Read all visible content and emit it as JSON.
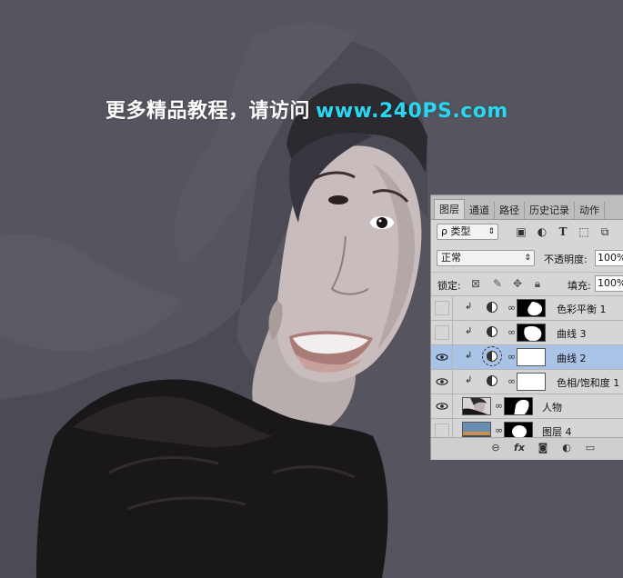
{
  "watermark": {
    "text": "更多精品教程，请访问",
    "url": "www.240PS.com"
  },
  "panel": {
    "tabs": [
      "图层",
      "通道",
      "路径",
      "历史记录",
      "动作"
    ],
    "filter": {
      "label": "ρ 类型",
      "icons": [
        "image-filter-icon",
        "adjustment-filter-icon",
        "type-filter-icon",
        "shape-filter-icon",
        "smart-object-filter-icon"
      ]
    },
    "blend_mode": "正常",
    "opacity_label": "不透明度:",
    "opacity_value": "100%",
    "lock_label": "锁定:",
    "fill_label": "填充:",
    "fill_value": "100%",
    "layers": [
      {
        "name": "色彩平衡 1",
        "visible": false,
        "selected": false
      },
      {
        "name": "曲线 3",
        "visible": false,
        "selected": false
      },
      {
        "name": "曲线 2",
        "visible": true,
        "selected": true
      },
      {
        "name": "色相/饱和度 1",
        "visible": true,
        "selected": false
      },
      {
        "name": "人物",
        "visible": true,
        "selected": false
      },
      {
        "name": "图层 4",
        "visible": false,
        "selected": false
      }
    ],
    "bottom_icons": [
      "link-icon",
      "fx-icon",
      "mask-icon",
      "adjustment-icon",
      "group-folder-icon"
    ]
  },
  "colors": {
    "background": "#56555f",
    "panel": "#d6d6d6",
    "selected_layer": "#a9c3e6",
    "watermark_url": "#2ad7f2"
  }
}
